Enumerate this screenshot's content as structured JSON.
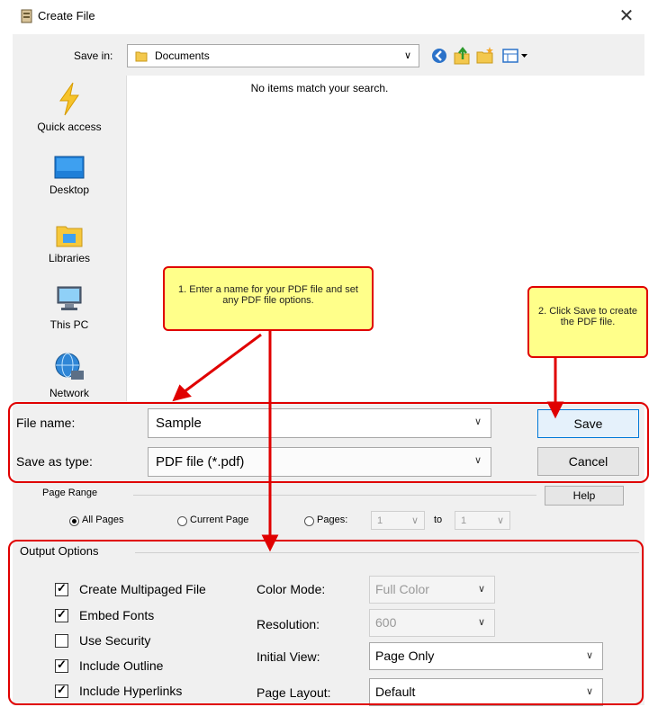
{
  "window": {
    "title": "Create File",
    "close_glyph": "✕"
  },
  "save_in": {
    "label": "Save in:",
    "value": "Documents"
  },
  "places": [
    {
      "label": "Quick access",
      "icon": "quick-access-icon"
    },
    {
      "label": "Desktop",
      "icon": "desktop-icon"
    },
    {
      "label": "Libraries",
      "icon": "libraries-icon"
    },
    {
      "label": "This PC",
      "icon": "this-pc-icon"
    },
    {
      "label": "Network",
      "icon": "network-icon"
    }
  ],
  "file_list": {
    "empty_message": "No items match your search."
  },
  "form": {
    "file_name_label": "File name:",
    "file_name_value": "Sample",
    "save_as_type_label": "Save as type:",
    "save_as_type_value": "PDF file (*.pdf)",
    "save_label": "Save",
    "cancel_label": "Cancel"
  },
  "page_range": {
    "label": "Page Range",
    "help_label": "Help",
    "all_pages": "All Pages",
    "current_page": "Current Page",
    "pages": "Pages:",
    "from_value": "1",
    "to_label": "to",
    "to_value": "1",
    "selected": "All Pages"
  },
  "output_options": {
    "label": "Output Options",
    "checkboxes": [
      {
        "label": "Create Multipaged File",
        "checked": true
      },
      {
        "label": "Embed Fonts",
        "checked": true
      },
      {
        "label": "Use Security",
        "checked": false
      },
      {
        "label": "Include Outline",
        "checked": true
      },
      {
        "label": "Include Hyperlinks",
        "checked": true
      }
    ],
    "color_mode_label": "Color Mode:",
    "color_mode_value": "Full Color",
    "resolution_label": "Resolution:",
    "resolution_value": "600",
    "initial_view_label": "Initial View:",
    "initial_view_value": "Page Only",
    "page_layout_label": "Page Layout:",
    "page_layout_value": "Default"
  },
  "annotations": {
    "callout_1": "1. Enter a name for your PDF file and set any PDF file options.",
    "callout_2": "2. Click Save to create the PDF file."
  },
  "colors": {
    "annotation_red": "#e00000",
    "callout_yellow": "#ffff8a",
    "dialog_bg": "#f0f0f0"
  }
}
